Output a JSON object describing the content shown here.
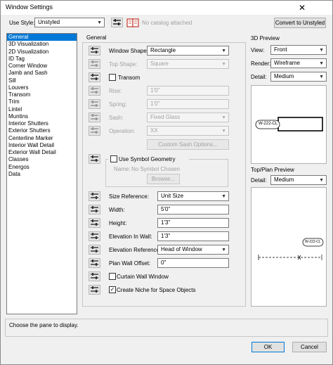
{
  "title": "Window Settings",
  "close_glyph": "✕",
  "top": {
    "use_style_label": "Use Style:",
    "use_style_value": "Unstyled",
    "catalog_text": "No catalog attached",
    "convert_button": "Convert to Unstyled"
  },
  "list_items": [
    "General",
    "3D Visualization",
    "2D Visualization",
    "ID Tag",
    "Corner Window",
    "Jamb and Sash",
    "Sill",
    "Louvers",
    "Transom",
    "Trim",
    "Lintel",
    "Muntins",
    "Interior Shutters",
    "Exterior Shutters",
    "Centerline Marker",
    "Interior Wall Detail",
    "Exterior Wall Detail",
    "Classes",
    "Energos",
    "Data"
  ],
  "general": {
    "group_title": "General",
    "window_shape_label": "Window Shape:",
    "window_shape_value": "Rectangle",
    "top_shape_label": "Top Shape:",
    "top_shape_value": "Square",
    "transom_label": "Transom",
    "rise_label": "Rise:",
    "rise_value": "1'0\"",
    "spring_label": "Spring:",
    "spring_value": "1'0\"",
    "sash_label": "Sash:",
    "sash_value": "Fixed Glass",
    "operation_label": "Operation:",
    "operation_value": "XX",
    "custom_sash_button": "Custom Sash Options...",
    "use_symbol_label": "Use Symbol Geometry",
    "name_label": "Name:",
    "name_value": "No Symbol Chosen",
    "browse_button": "Browse...",
    "size_reference_label": "Size Reference:",
    "size_reference_value": "Unit Size",
    "width_label": "Width:",
    "width_value": "5'0\"",
    "height_label": "Height:",
    "height_value": "1'3\"",
    "elevation_in_wall_label": "Elevation In Wall:",
    "elevation_in_wall_value": "1'3\"",
    "elevation_reference_label": "Elevation Reference:",
    "elevation_reference_value": "Head of Window",
    "plan_wall_offset_label": "Plan Wall Offset:",
    "plan_wall_offset_value": "0\"",
    "curtain_wall_label": "Curtain Wall Window",
    "create_niche_label": "Create Niche for Space Objects",
    "check_glyph": "✓"
  },
  "preview3d": {
    "title": "3D Preview",
    "view_label": "View:",
    "view_value": "Front",
    "render_label": "Render:",
    "render_value": "Wireframe",
    "detail_label": "Detail:",
    "detail_value": "Medium",
    "tag_text": "W-222-CL"
  },
  "preview2d": {
    "title": "Top/Plan Preview",
    "detail_label": "Detail:",
    "detail_value": "Medium",
    "tag_text": "W-222-CL"
  },
  "status_text": "Choose the pane to display.",
  "ok_button": "OK",
  "cancel_button": "Cancel",
  "colors": {
    "selection": "#0078d7",
    "dialog_bg": "#f0f0f0",
    "catalog_icon": "#c0392b"
  },
  "dropdown_arrow": "▼"
}
